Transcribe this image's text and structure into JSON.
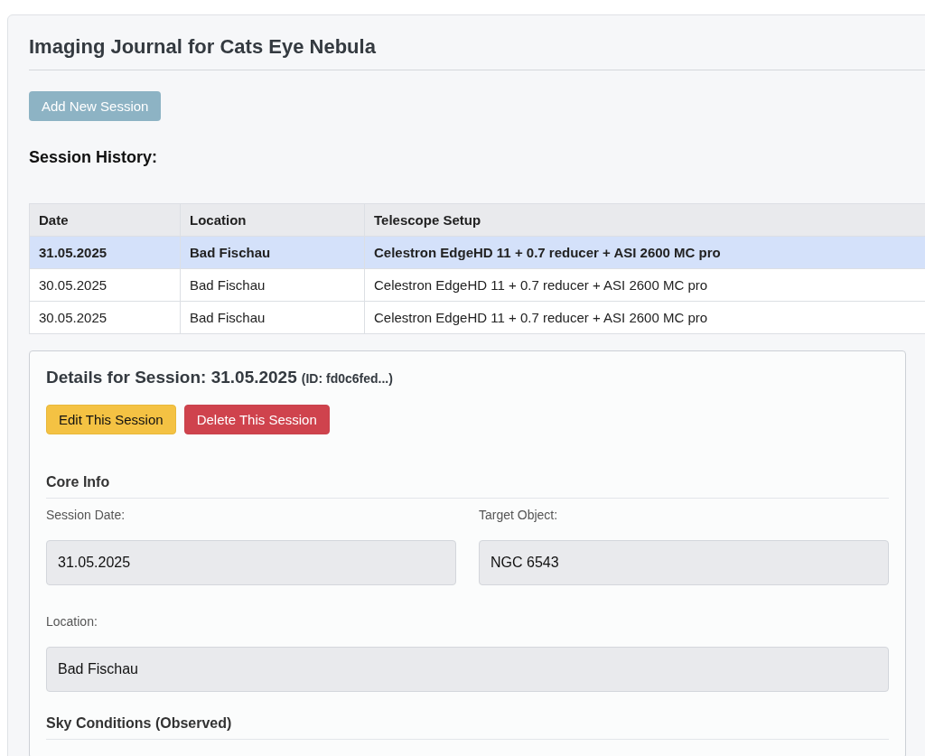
{
  "title": "Imaging Journal for Cats Eye Nebula",
  "add_button": "Add New Session",
  "history_heading": "Session History:",
  "table": {
    "columns": [
      "Date",
      "Location",
      "Telescope Setup"
    ],
    "rows": [
      {
        "cells": [
          "31.05.2025",
          "Bad Fischau",
          "Celestron EdgeHD 11 + 0.7 reducer + ASI 2600 MC pro"
        ],
        "selected": true
      },
      {
        "cells": [
          "30.05.2025",
          "Bad Fischau",
          "Celestron EdgeHD 11 + 0.7 reducer + ASI 2600 MC pro"
        ],
        "selected": false
      },
      {
        "cells": [
          "30.05.2025",
          "Bad Fischau",
          "Celestron EdgeHD 11 + 0.7 reducer + ASI 2600 MC pro"
        ],
        "selected": false
      }
    ]
  },
  "details": {
    "title": "Details for Session: 31.05.2025",
    "id_note": "(ID: fd0c6fed...)",
    "buttons": [
      {
        "label": "Edit This Session",
        "kind": "edit"
      },
      {
        "label": "Delete This Session",
        "kind": "delete"
      }
    ],
    "sections": [
      {
        "heading": "Core Info",
        "rows": [
          [
            {
              "label": "Session Date:",
              "value": "31.05.2025"
            },
            {
              "label": "Target Object:",
              "value": "NGC 6543"
            }
          ],
          [
            {
              "label": "Location:",
              "value": "Bad Fischau"
            }
          ]
        ]
      },
      {
        "heading": "Sky Conditions (Observed)"
      }
    ]
  }
}
